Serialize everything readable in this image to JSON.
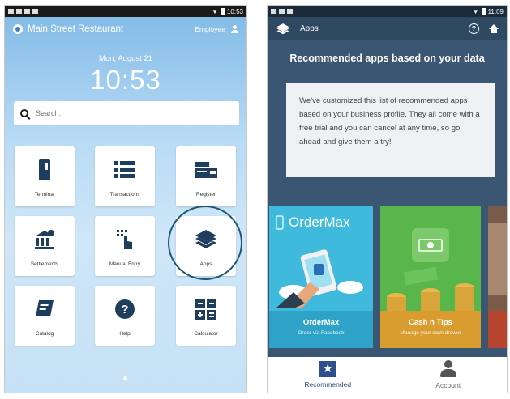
{
  "left_screen": {
    "status_time": "10:53",
    "restaurant_name": "Main Street Restaurant",
    "employee_label": "Employee",
    "date": "Mon, August 21",
    "clock": "10:53",
    "search_placeholder": "Search:",
    "tiles": [
      {
        "label": "Terminal",
        "icon": "card-terminal-icon"
      },
      {
        "label": "Transactions",
        "icon": "list-icon"
      },
      {
        "label": "Register",
        "icon": "register-icon"
      },
      {
        "label": "Settlements",
        "icon": "bank-icon"
      },
      {
        "label": "Manual Entry",
        "icon": "hand-keypad-icon"
      },
      {
        "label": "Apps",
        "icon": "layers-icon"
      },
      {
        "label": "Catalog",
        "icon": "book-icon"
      },
      {
        "label": "Help",
        "icon": "question-icon"
      },
      {
        "label": "Calculator",
        "icon": "calculator-icon"
      }
    ],
    "highlight_color": "#1c5577"
  },
  "right_screen": {
    "status_time": "11:09",
    "title": "Apps",
    "heading": "Recommended apps based on your data",
    "info_text": "We've customized this list of recommended apps based on your business profile. They all come with a free trial and you can cancel at any time, so go ahead and give them a try!",
    "apps": [
      {
        "banner": "OrderMax",
        "name": "OrderMax",
        "subtitle": "Order via Facebook",
        "color": "#3fb9dc"
      },
      {
        "banner": "",
        "name": "Cash n Tips",
        "subtitle": "Manage your cash drawer",
        "color": "#58b64a"
      }
    ],
    "nav": [
      {
        "label": "Recommended",
        "active": true
      },
      {
        "label": "Account",
        "active": false
      }
    ],
    "colors": {
      "header": "#2f4962",
      "background": "#3b5672",
      "accent": "#2f4f8c"
    }
  }
}
